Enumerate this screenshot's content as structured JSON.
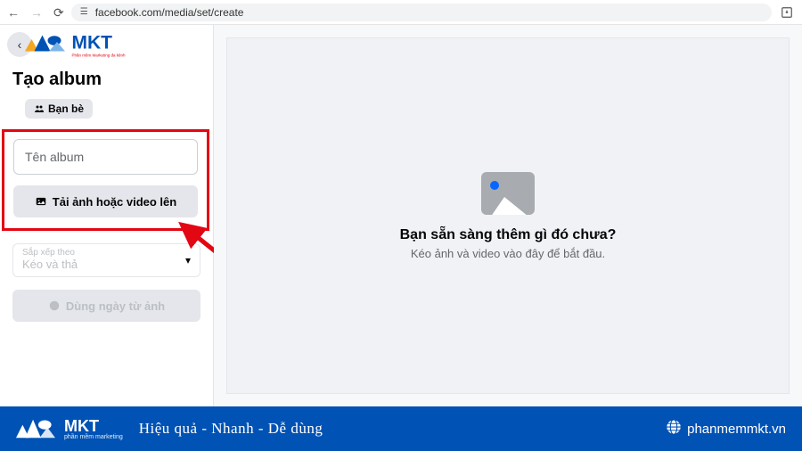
{
  "browser": {
    "url": "facebook.com/media/set/create"
  },
  "logo": {
    "text": "MKT",
    "subtitle": "Phần mềm Marketing đa kênh"
  },
  "sidebar": {
    "title": "Tạo album",
    "privacy_label": "Bạn bè",
    "name_placeholder": "Tên album",
    "upload_label": "Tải ảnh hoặc video lên",
    "sort_label": "Sắp xếp theo",
    "sort_value": "Kéo và thả",
    "date_label": "Dùng ngày từ ảnh"
  },
  "preview": {
    "empty_title": "Bạn sẵn sàng thêm gì đó chưa?",
    "empty_sub": "Kéo ảnh và video vào đây để bắt đầu."
  },
  "footer": {
    "brand": "MKT",
    "brand_sub": "phần mềm marketing",
    "tagline": "Hiệu quả - Nhanh  - Dễ dùng",
    "url": "phanmemmkt.vn"
  }
}
